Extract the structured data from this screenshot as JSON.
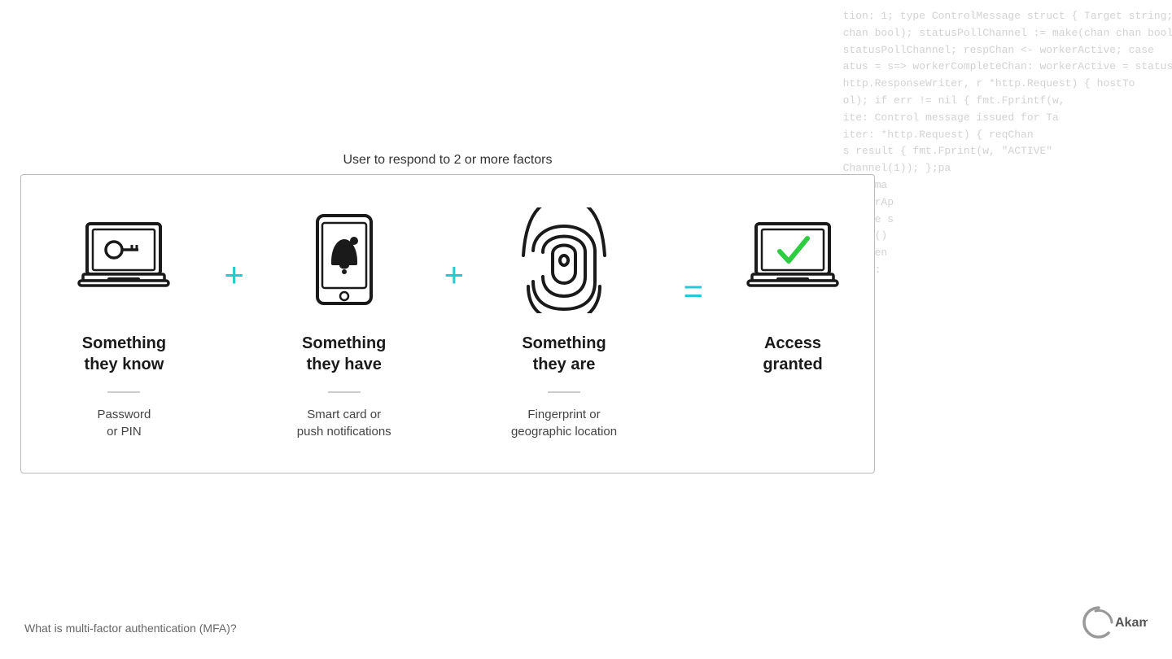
{
  "codeBg": {
    "lines": [
      "tion: 1; type ControlMessage struct { Target string; Co",
      "chan bool); statusPollChannel := make(chan chan bool); v",
      "statusPollChannel; respChan <- workerActive; case",
      "atus = s=> workerCompleteChan: workerActive = status;",
      "http.ResponseWriter, r *http.Request) { hostTo",
      "ol); if err != nil { fmt.Fprintf(w,",
      "ite: Control message issued for Ta",
      "iter: *http.Request) { reqChan",
      "s result { fmt.Fprint(w, \"ACTIVE\"",
      "Channel(1)); };pa",
      "func ma",
      "workerAp",
      "Msg re s",
      "admin()",
      "ctToken",
      "tlr(w:",
      "",
      "",
      "",
      "",
      "",
      ""
    ]
  },
  "diagram": {
    "title": "User to respond to 2 or more factors",
    "factors": [
      {
        "id": "know",
        "label": "Something\nthey know",
        "sublabel": "Password\nor PIN",
        "icon": "laptop-key"
      },
      {
        "id": "have",
        "label": "Something\nthey have",
        "sublabel": "Smart card or\npush notifications",
        "icon": "phone-bell"
      },
      {
        "id": "are",
        "label": "Something\nthey are",
        "sublabel": "Fingerprint or\ngeographic location",
        "icon": "fingerprint"
      }
    ],
    "result": {
      "label": "Access\ngranted",
      "icon": "laptop-check"
    },
    "operators": {
      "plus": "+",
      "equals": "="
    }
  },
  "footer": {
    "label": "What is multi-factor authentication (MFA)?",
    "brand": "Akamai"
  }
}
